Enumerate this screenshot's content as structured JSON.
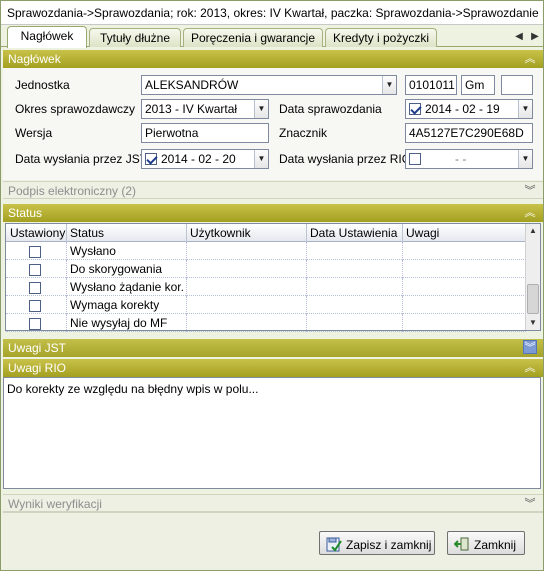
{
  "window": {
    "title": "Sprawozdania->Sprawozdania; rok: 2013, okres: IV Kwartał, paczka: Sprawozdania->Sprawozdanie Rb-Z"
  },
  "tabs": [
    {
      "label": "Nagłówek",
      "active": true
    },
    {
      "label": "Tytuły dłużne",
      "active": false
    },
    {
      "label": "Poręczenia i gwarancje",
      "active": false
    },
    {
      "label": "Kredyty i pożyczki",
      "active": false
    }
  ],
  "sections": {
    "naglowek": "Nagłówek",
    "podpis": "Podpis elektroniczny (2)",
    "status": "Status",
    "uwagi_jst": "Uwagi JST",
    "uwagi_rio": "Uwagi RIO",
    "wyniki": "Wyniki weryfikacji"
  },
  "form": {
    "jednostka_label": "Jednostka",
    "jednostka_value": "ALEKSANDRÓW",
    "code_value": "0101011",
    "type_value": "Gm",
    "extra_value": "",
    "okres_label": "Okres sprawozdawczy",
    "okres_value": "2013 - IV Kwartał",
    "data_spr_label": "Data sprawozdania",
    "data_spr_value": "2014  -  02  -  19",
    "wersja_label": "Wersja",
    "wersja_value": "Pierwotna",
    "znacznik_label": "Znacznik",
    "znacznik_value": "4A5127E7C290E68D",
    "data_jst_label": "Data wysłania przez JST",
    "data_jst_value": "2014  -  02  -  20",
    "data_rio_label": "Data wysłania przez RIO",
    "data_rio_value": "-         -"
  },
  "status_grid": {
    "columns": [
      "Ustawiony",
      "Status",
      "Użytkownik",
      "Data Ustawienia",
      "Uwagi"
    ],
    "rows": [
      {
        "checked": false,
        "status": "Wysłano",
        "user": "",
        "date": "",
        "notes": ""
      },
      {
        "checked": false,
        "status": "Do skorygowania",
        "user": "",
        "date": "",
        "notes": ""
      },
      {
        "checked": false,
        "status": "Wysłano żądanie kor...",
        "user": "",
        "date": "",
        "notes": ""
      },
      {
        "checked": false,
        "status": "Wymaga korekty",
        "user": "",
        "date": "",
        "notes": ""
      },
      {
        "checked": false,
        "status": "Nie wysyłaj do MF",
        "user": "",
        "date": "",
        "notes": ""
      }
    ]
  },
  "uwagi_rio_text": "Do korekty ze względu na błędny wpis w polu...",
  "buttons": {
    "save_close": "Zapisz i zamknij",
    "close": "Zamknij"
  },
  "colors": {
    "section_active": "#b3b036",
    "accent_blue": "#1d3c8a"
  }
}
